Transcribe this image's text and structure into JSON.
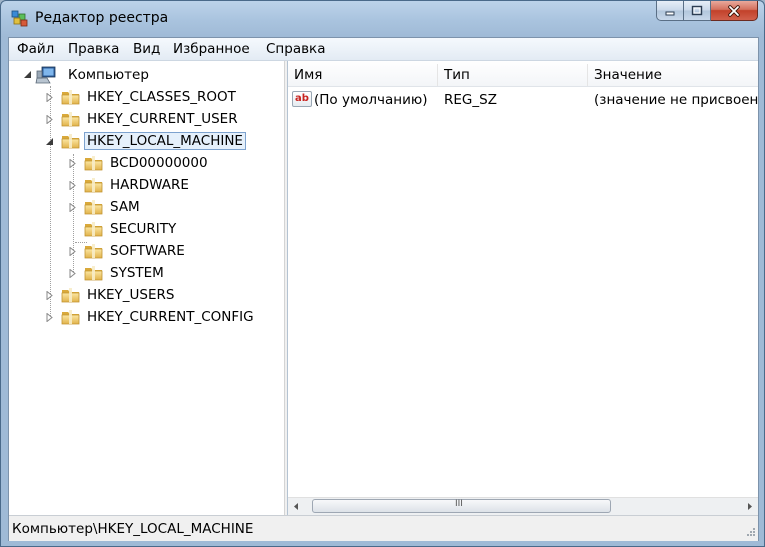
{
  "window": {
    "title": "Редактор реестра",
    "app_icon": "regedit-icon",
    "caption_buttons": [
      "minimize-icon",
      "maximize-icon",
      "close-icon"
    ]
  },
  "menu": {
    "items": [
      "Файл",
      "Правка",
      "Вид",
      "Избранное",
      "Справка"
    ]
  },
  "tree": {
    "root": "Компьютер",
    "hives": [
      {
        "label": "HKEY_CLASSES_ROOT",
        "expanded": false
      },
      {
        "label": "HKEY_CURRENT_USER",
        "expanded": false
      },
      {
        "label": "HKEY_LOCAL_MACHINE",
        "expanded": true,
        "selected": true
      },
      {
        "label": "HKEY_USERS",
        "expanded": false
      },
      {
        "label": "HKEY_CURRENT_CONFIG",
        "expanded": false
      }
    ],
    "hklm_children": [
      {
        "label": "BCD00000000",
        "has_children": true
      },
      {
        "label": "HARDWARE",
        "has_children": true
      },
      {
        "label": "SAM",
        "has_children": true
      },
      {
        "label": "SECURITY",
        "has_children": false
      },
      {
        "label": "SOFTWARE",
        "has_children": true
      },
      {
        "label": "SYSTEM",
        "has_children": true
      }
    ]
  },
  "list": {
    "columns": [
      "Имя",
      "Тип",
      "Значение"
    ],
    "rows": [
      {
        "icon": "string-value-icon",
        "icon_text": "ab",
        "name": "(По умолчанию)",
        "type": "REG_SZ",
        "value": "(значение не присвоено)"
      }
    ],
    "scroll_grip": "III"
  },
  "status": {
    "path": "Компьютер\\HKEY_LOCAL_MACHINE"
  },
  "colors": {
    "titlebar": "#a9c3de",
    "close_button": "#c2412a",
    "selection": "#e5f0fb",
    "folder": "#e8c15a"
  }
}
